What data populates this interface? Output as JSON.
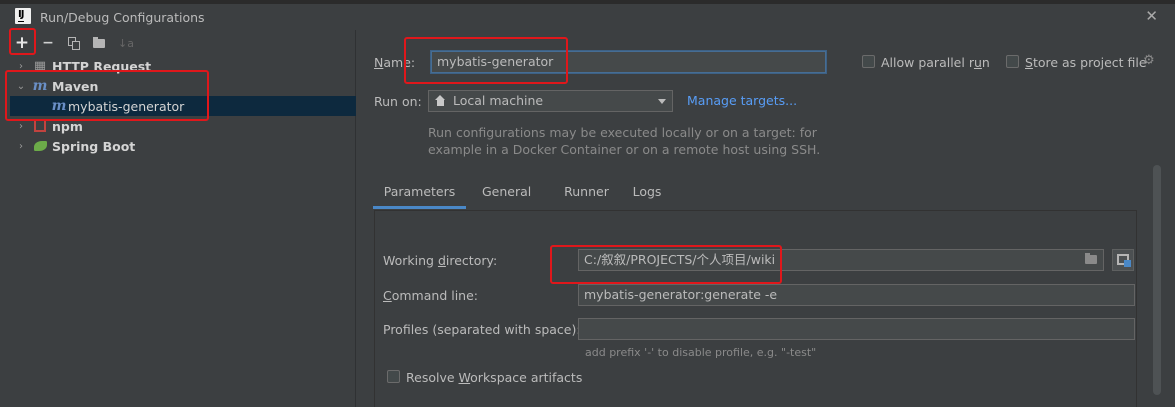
{
  "window": {
    "title": "Run/Debug Configurations",
    "close_glyph": "✕"
  },
  "toolbar": {
    "add_glyph": "+",
    "remove_glyph": "−",
    "sort_glyph": "↓a"
  },
  "tree": {
    "items": [
      {
        "label": "HTTP Request",
        "expanded": false,
        "icon": "http-request-icon"
      },
      {
        "label": "Maven",
        "expanded": true,
        "icon": "maven-icon"
      },
      {
        "label": "mybatis-generator",
        "selected": true,
        "icon": "maven-icon"
      },
      {
        "label": "npm",
        "expanded": false,
        "icon": "npm-icon"
      },
      {
        "label": "Spring Boot",
        "expanded": false,
        "icon": "spring-boot-icon"
      }
    ],
    "collapsed_glyph": "›",
    "expanded_glyph": "⌄",
    "maven_glyph": "m"
  },
  "form": {
    "name_label_underlined": "N",
    "name_label_rest": "ame:",
    "name_value": "mybatis-generator",
    "allow_parallel_pre": "Allow parallel r",
    "allow_parallel_u": "u",
    "allow_parallel_post": "n",
    "store_project_pre": "S",
    "store_project_post": "tore as project file",
    "gear_glyph": "⚙",
    "run_on_label": "Run on:",
    "run_on_value": "Local machine",
    "manage_targets": "Manage targets...",
    "hint_line1": "Run configurations may be executed locally or on a target: for",
    "hint_line2": "example in a Docker Container or on a remote host using SSH."
  },
  "tabs": [
    "Parameters",
    "General",
    "Runner",
    "Logs"
  ],
  "parameters": {
    "working_dir_pre": "Working ",
    "working_dir_u": "d",
    "working_dir_post": "irectory:",
    "working_dir_value": "C:/叙叙/PROJECTS/个人项目/wiki",
    "command_line_pre": "C",
    "command_line_post": "ommand line:",
    "command_line_value": "mybatis-generator:generate -e",
    "profiles_label": "Profiles (separated with space):",
    "profiles_value": "",
    "profiles_hint": "add prefix '-' to disable profile, e.g. \"-test\"",
    "resolve_pre": "Resolve ",
    "resolve_u": "W",
    "resolve_post": "orkspace artifacts"
  }
}
